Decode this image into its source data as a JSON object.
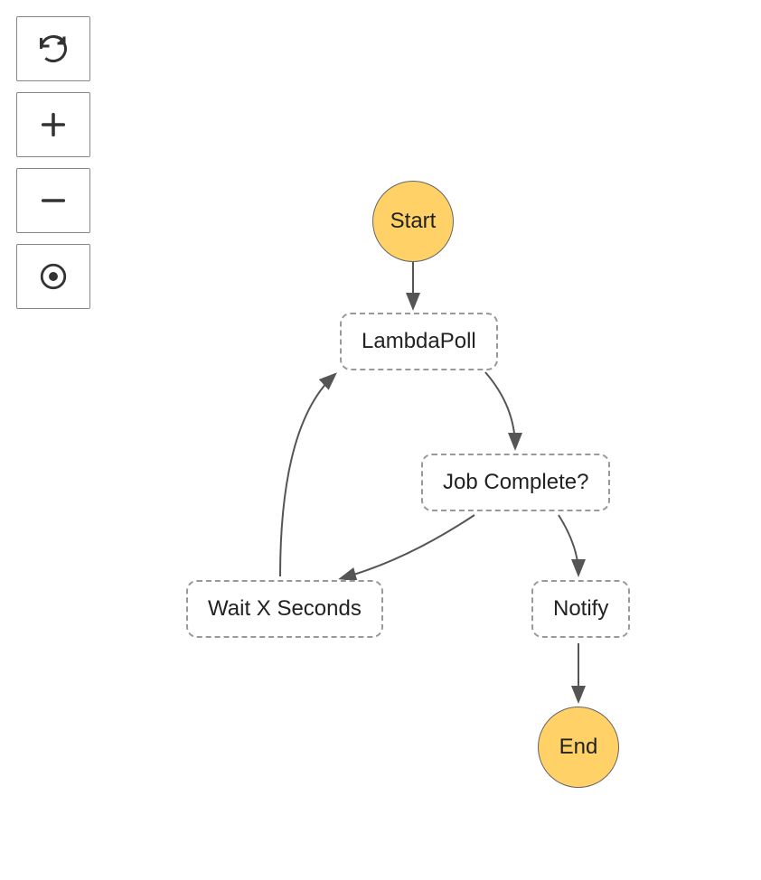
{
  "toolbar": {
    "reset": "reset",
    "zoom_in": "zoom-in",
    "zoom_out": "zoom-out",
    "center": "center"
  },
  "nodes": {
    "start": "Start",
    "lambdapoll": "LambdaPoll",
    "job_complete": "Job Complete?",
    "wait": "Wait X Seconds",
    "notify": "Notify",
    "end": "End"
  },
  "colors": {
    "circle_fill": "#ffd166",
    "circle_stroke": "#666",
    "box_stroke": "#999",
    "arrow": "#555"
  },
  "diagram": {
    "type": "flowchart",
    "edges": [
      {
        "from": "start",
        "to": "lambdapoll"
      },
      {
        "from": "lambdapoll",
        "to": "job_complete"
      },
      {
        "from": "job_complete",
        "to": "wait"
      },
      {
        "from": "job_complete",
        "to": "notify"
      },
      {
        "from": "wait",
        "to": "lambdapoll"
      },
      {
        "from": "notify",
        "to": "end"
      }
    ]
  }
}
